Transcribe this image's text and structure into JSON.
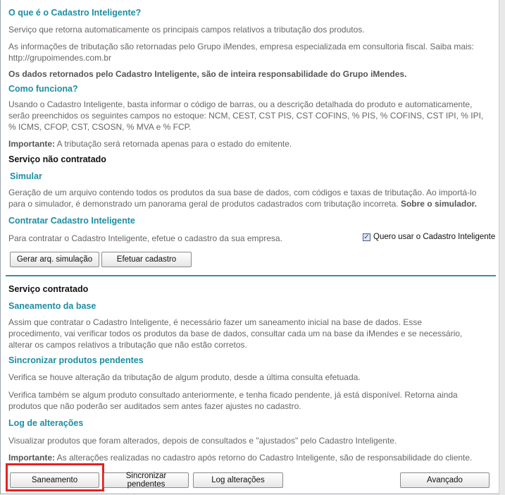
{
  "intro": {
    "heading": "O que é o Cadastro Inteligente?",
    "p1": "Serviço que retorna automaticamente os principais campos relativos a tributação dos produtos.",
    "p2_line1": "As informações de tributação são retornadas pelo Grupo iMendes, empresa especializada em consultoria fiscal. Saiba mais:",
    "p2_line2": "http://grupoimendes.com.br",
    "p3": "Os dados retornados pelo Cadastro Inteligente, são de inteira responsabilidade do Grupo iMendes."
  },
  "how": {
    "heading": "Como funciona?",
    "line1": "Usando o Cadastro Inteligente, basta informar o código de barras, ou a descrição detalhada do produto e automaticamente,",
    "line2": "serão preenchidos os seguintes campos no estoque: NCM, CEST, CST PIS, CST COFINS, % PIS, % COFINS, CST IPI, % IPI,",
    "line3": "% ICMS, CFOP, CST, CSOSN, % MVA e % FCP.",
    "important_label": "Importante:",
    "important_text": " A tributação será retornada apenas para o estado do emitente."
  },
  "not_contracted": {
    "heading": "Serviço não contratado",
    "simular": {
      "heading": "Simular",
      "line1": "Geração de um arquivo contendo todos os produtos da sua base de dados, com códigos e taxas de tributação. Ao importá-lo",
      "line2": "para o simulador, é demonstrado um panorama geral de produtos cadastrados com tributação incorreta.",
      "link": " Sobre o simulador."
    },
    "contratar": {
      "heading": "Contratar Cadastro Inteligente",
      "text": "Para contratar o Cadastro Inteligente, efetue o cadastro da sua empresa.",
      "checkbox_label": "Quero usar o Cadastro Inteligente",
      "checkbox_checked": true
    },
    "buttons": {
      "simulate": "Gerar arq. simulação",
      "register": "Efetuar cadastro"
    }
  },
  "contracted": {
    "heading": "Serviço contratado",
    "saneamento": {
      "heading": "Saneamento da base",
      "line1": "Assim que contratar o Cadastro Inteligente, é necessário fazer um saneamento inicial na base de dados. Esse",
      "line2": "procedimento, vai verificar todos os produtos da base de dados, consultar cada um na base da iMendes e se necessário,",
      "line3": "alterar os campos relativos a tributação que não estão corretos."
    },
    "sincronizar": {
      "heading": "Sincronizar produtos pendentes",
      "p1": "Verifica se houve alteração da tributação de algum produto, desde a última consulta efetuada.",
      "p2_line1": "Verifica também se algum produto consultado anteriormente, e tenha ficado pendente, já está disponível. Retorna ainda",
      "p2_line2": "produtos que não poderão ser auditados sem antes fazer ajustes no cadastro."
    },
    "log": {
      "heading": "Log de alterações",
      "text": "Visualizar produtos que foram alterados, depois de consultados e \"ajustados\" pelo Cadastro Inteligente.",
      "important_label": "Importante:",
      "important_text": "  As alterações realizadas no cadastro após retorno do Cadastro Inteligente, são de responsabilidade do cliente."
    },
    "buttons": {
      "saneamento": "Saneamento",
      "sync": "Sincronizar pendentes",
      "log": "Log alterações",
      "advanced": "Avançado"
    }
  },
  "colors": {
    "heading": "#1d8ea2",
    "divider": "#3b8fa0",
    "highlight": "#e32222"
  }
}
